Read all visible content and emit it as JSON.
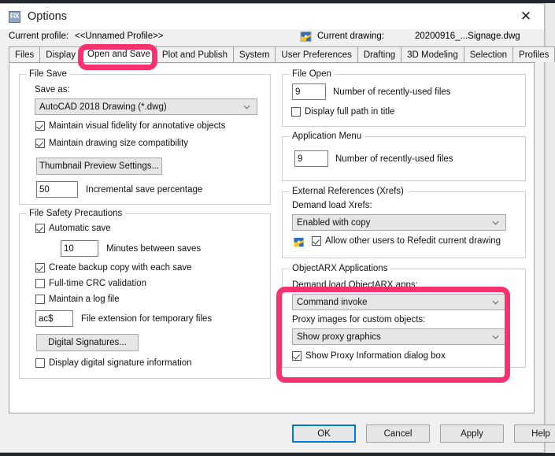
{
  "window": {
    "title": "Options",
    "app_icon": "fx-icon",
    "close_label": "✕"
  },
  "header": {
    "current_profile_label": "Current profile:",
    "current_profile_value": "<<Unnamed Profile>>",
    "current_drawing_label": "Current drawing:",
    "current_drawing_value": "20200916_...Signage.dwg",
    "drawing_icon": "dwg-file-icon"
  },
  "tabs": [
    {
      "label": "Files",
      "active": false
    },
    {
      "label": "Display",
      "active": false
    },
    {
      "label": "Open and Save",
      "active": true
    },
    {
      "label": "Plot and Publish",
      "active": false
    },
    {
      "label": "System",
      "active": false
    },
    {
      "label": "User Preferences",
      "active": false
    },
    {
      "label": "Drafting",
      "active": false
    },
    {
      "label": "3D Modeling",
      "active": false
    },
    {
      "label": "Selection",
      "active": false
    },
    {
      "label": "Profiles",
      "active": false
    }
  ],
  "file_save": {
    "legend": "File Save",
    "save_as_label": "Save as:",
    "save_as_value": "AutoCAD 2018 Drawing (*.dwg)",
    "maintain_visual_fidelity": {
      "label": "Maintain visual fidelity for annotative objects",
      "checked": true
    },
    "maintain_size_compat": {
      "label": "Maintain drawing size compatibility",
      "checked": true
    },
    "thumbnail_button": "Thumbnail Preview Settings...",
    "incremental_value": "50",
    "incremental_label": "Incremental save percentage"
  },
  "file_safety": {
    "legend": "File Safety Precautions",
    "automatic_save": {
      "label": "Automatic save",
      "checked": true
    },
    "minutes_value": "10",
    "minutes_label": "Minutes between saves",
    "create_backup": {
      "label": "Create backup copy with each save",
      "checked": true
    },
    "crc_validation": {
      "label": "Full-time CRC validation",
      "checked": false
    },
    "log_file": {
      "label": "Maintain a log file",
      "checked": false
    },
    "temp_ext_value": "ac$",
    "temp_ext_label": "File extension for temporary files",
    "digital_signatures_button": "Digital Signatures...",
    "display_digital_sig": {
      "label": "Display digital signature information",
      "checked": false
    }
  },
  "file_open": {
    "legend": "File Open",
    "recent_value": "9",
    "recent_label": "Number of recently-used files",
    "full_path": {
      "label": "Display full path in title",
      "checked": false
    }
  },
  "application_menu": {
    "legend": "Application Menu",
    "recent_value": "9",
    "recent_label": "Number of recently-used files"
  },
  "xrefs": {
    "legend": "External References (Xrefs)",
    "demand_load_label": "Demand load Xrefs:",
    "demand_load_value": "Enabled with copy",
    "refedit_icon": "dwg-file-icon",
    "refedit": {
      "label": "Allow other users to Refedit current drawing",
      "checked": true
    }
  },
  "objectarx": {
    "legend": "ObjectARX Applications",
    "demand_load_label": "Demand load ObjectARX apps:",
    "demand_load_value": "Command invoke",
    "proxy_images_label": "Proxy images for custom objects:",
    "proxy_images_value": "Show proxy graphics",
    "show_proxy_dialog": {
      "label": "Show Proxy Information dialog box",
      "checked": true
    }
  },
  "footer": {
    "ok": "OK",
    "cancel": "Cancel",
    "apply": "Apply",
    "help": "Help"
  },
  "annotations": {
    "highlight_color": "#f9316f",
    "targets": [
      "tab-open-and-save",
      "objectarx-group"
    ]
  }
}
